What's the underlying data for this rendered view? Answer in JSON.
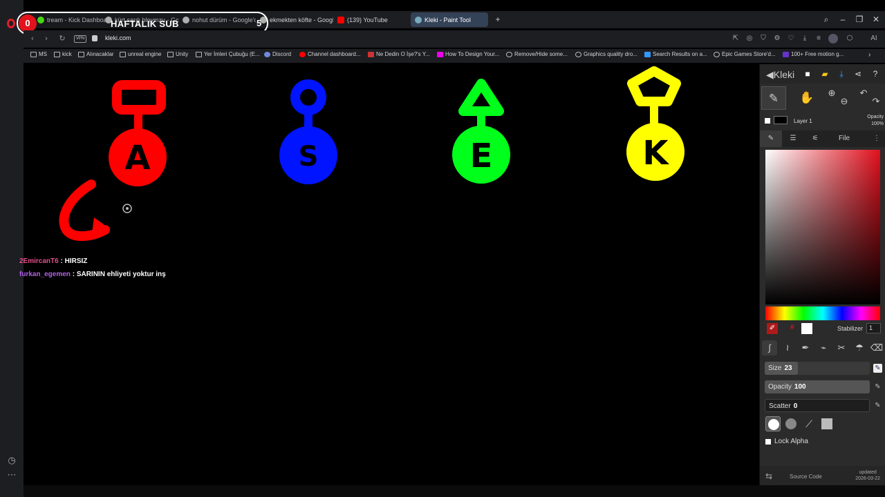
{
  "overlay": {
    "sub_count_left": "0",
    "sub_label": "HAFTALIK SUB",
    "sub_count_right": "5"
  },
  "tabs": [
    {
      "label": "tream - Kick Dashboard",
      "icon": "kick-icon"
    },
    {
      "label": "kürt sarılı bloymzu - Go",
      "icon": "google-icon"
    },
    {
      "label": "nohut dürüm - Google'da",
      "icon": "google-icon"
    },
    {
      "label": "ekmekten köfte - Google'd",
      "icon": "google-icon"
    },
    {
      "label": "(139) YouTube",
      "icon": "youtube-icon"
    },
    {
      "label": "Kleki - Paint Tool",
      "icon": "kleki-icon",
      "active": true
    }
  ],
  "address": {
    "vpn": "VPN",
    "url": "kleki.com"
  },
  "bookmarks": [
    "MS",
    "kick",
    "Alınacaklar",
    "unreal engine",
    "Unity",
    "Yer İmleri Çubuğu (E...",
    "Discord",
    "Channel dashboard...",
    "Ne Dedin O İşe?'s Y...",
    "How To Design Your...",
    "Remove/Hide some...",
    "Graphics quality dro...",
    "Search Results on a...",
    "Epic Games Store'd...",
    "100+ Free motion g..."
  ],
  "chat": [
    {
      "user": "2EmircanT6",
      "sep": " : ",
      "message": "HIRSIZ",
      "color": "#e0508a"
    },
    {
      "user": "furkan_egemen",
      "sep": " : ",
      "message": "SARININ ehliyeti yoktur inş",
      "color": "#b061e6"
    }
  ],
  "drawing": {
    "figures": [
      {
        "letter": "A",
        "color": "#ff0000",
        "head_shape": "rectangle"
      },
      {
        "letter": "S",
        "color": "#0014ff",
        "head_shape": "circle"
      },
      {
        "letter": "E",
        "color": "#00ff1a",
        "head_shape": "triangle"
      },
      {
        "letter": "K",
        "color": "#ffff00",
        "head_shape": "diamond"
      }
    ],
    "arrow_color": "#ff0000"
  },
  "kleki": {
    "logo": "Kleki",
    "layer": {
      "name": "Layer 1",
      "opacity_label": "Opacity",
      "opacity_value": "100%"
    },
    "tabs": {
      "file": "File"
    },
    "stabilizer": {
      "label": "Stabilizer",
      "value": "1"
    },
    "size": {
      "label": "Size",
      "value": "23"
    },
    "opacity": {
      "label": "Opacity",
      "value": "100"
    },
    "scatter": {
      "label": "Scatter",
      "value": "0"
    },
    "lock_alpha": "Lock Alpha",
    "footer": {
      "source": "Source Code",
      "updated_label": "updated",
      "updated_date": "2026-03-22"
    },
    "primary_color": "#ffffff",
    "picker_hue": "#e0101d"
  }
}
